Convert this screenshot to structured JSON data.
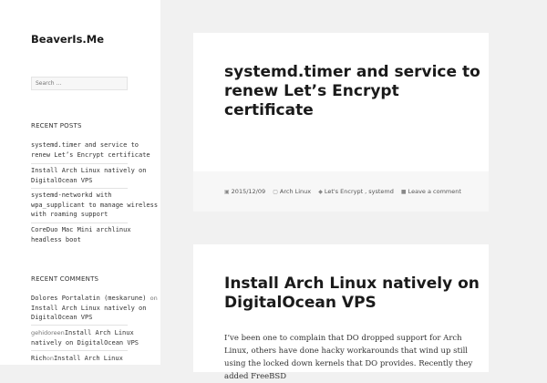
{
  "site": {
    "title": "BeaverIs.Me"
  },
  "search": {
    "placeholder": "Search …"
  },
  "recent_posts": {
    "title": "RECENT POSTS",
    "items": [
      {
        "label": "systemd.timer and service to renew Let’s Encrypt certificate"
      },
      {
        "label": "Install Arch Linux natively on DigitalOcean VPS"
      },
      {
        "label": "systemd-networkd with wpa_supplicant to manage wireless with roaming support"
      },
      {
        "label": "CoreDuo Mac Mini archlinux headless boot"
      }
    ]
  },
  "recent_comments": {
    "title": "RECENT COMMENTS",
    "items": [
      {
        "author": "Dolores Portalatin (meskarune)",
        "on": "on",
        "post": "Install Arch Linux natively on DigitalOcean VPS"
      },
      {
        "author": "gehidoreen",
        "on": "on",
        "post": "Install Arch Linux natively on DigitalOcean VPS"
      },
      {
        "author": "Rich",
        "on": "on",
        "post": "Install Arch Linux"
      }
    ]
  },
  "posts": [
    {
      "title": "systemd.timer and service to renew Let’s Encrypt certificate",
      "meta": {
        "date": "2015/12/09",
        "category": "Arch Linux",
        "tags": "Let's Encrypt",
        "tag_sep": ",",
        "tag2": "systemd",
        "comment": "Leave a comment"
      }
    },
    {
      "title": "Install Arch Linux natively on DigitalOcean VPS",
      "excerpt": "I’ve been one to complain that DO dropped support for Arch Linux, others have done hacky workarounds that wind up still using the locked down kernels that DO provides. Recently they added FreeBSD"
    }
  ],
  "icons": {
    "calendar": "calendar-icon",
    "folder": "folder-icon",
    "tag": "tag-icon",
    "comment": "comment-icon"
  }
}
